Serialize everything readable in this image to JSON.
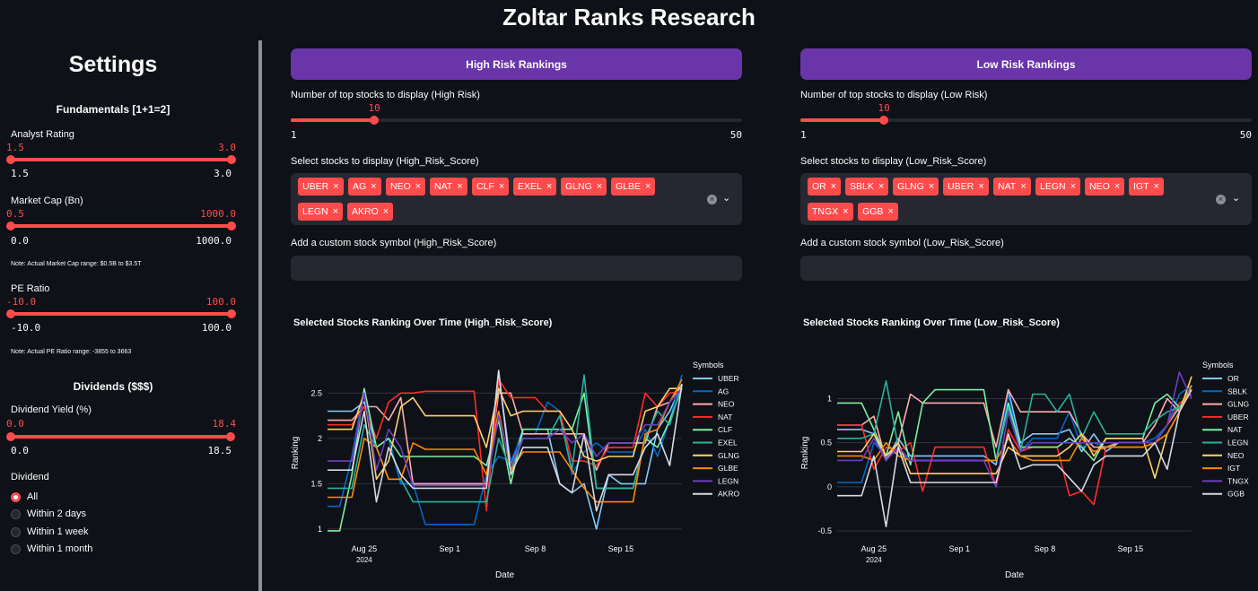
{
  "app": {
    "title": "Zoltar Ranks Research"
  },
  "sidebar": {
    "title": "Settings",
    "fundamentals_header": "Fundamentals [1+1=2]",
    "analyst_rating": {
      "label": "Analyst Rating",
      "low": "1.5",
      "high": "3.0",
      "min": "1.5",
      "max": "3.0",
      "low_frac": 0,
      "high_frac": 1
    },
    "market_cap": {
      "label": "Market Cap (Bn)",
      "low": "0.5",
      "high": "1000.0",
      "min": "0.0",
      "max": "1000.0",
      "note": "Note: Actual Market Cap range: $0.5B to $3.5T",
      "low_frac": 0,
      "high_frac": 1
    },
    "pe_ratio": {
      "label": "PE Ratio",
      "low": "-10.0",
      "high": "100.0",
      "min": "-10.0",
      "max": "100.0",
      "note": "Note: Actual PE Ratio range: -3855 to 3663",
      "low_frac": 0,
      "high_frac": 1
    },
    "dividends_header": "Dividends ($$$)",
    "dividend_yield": {
      "label": "Dividend Yield (%)",
      "low": "0.0",
      "high": "18.4",
      "min": "0.0",
      "max": "18.5",
      "low_frac": 0,
      "high_frac": 0.995
    },
    "dividend": {
      "label": "Dividend",
      "options": [
        "All",
        "Within 2 days",
        "Within 1 week",
        "Within 1 month"
      ],
      "selected": "All"
    }
  },
  "high": {
    "button": "High Risk Rankings",
    "slider_label": "Number of top stocks to display (High Risk)",
    "slider_value": "10",
    "slider_min": "1",
    "slider_max": "50",
    "slider_frac": 0.184,
    "select_label": "Select stocks to display (High_Risk_Score)",
    "chips": [
      "UBER",
      "AG",
      "NEO",
      "NAT",
      "CLF",
      "EXEL",
      "GLNG",
      "GLBE",
      "LEGN",
      "AKRO"
    ],
    "custom_label": "Add a custom stock symbol (High_Risk_Score)",
    "custom_value": ""
  },
  "low": {
    "button": "Low Risk Rankings",
    "slider_label": "Number of top stocks to display (Low Risk)",
    "slider_value": "10",
    "slider_min": "1",
    "slider_max": "50",
    "slider_frac": 0.184,
    "select_label": "Select stocks to display (Low_Risk_Score)",
    "chips": [
      "OR",
      "SBLK",
      "GLNG",
      "UBER",
      "NAT",
      "LEGN",
      "NEO",
      "IGT",
      "TNGX",
      "GGB"
    ],
    "custom_label": "Add a custom stock symbol (Low_Risk_Score)",
    "custom_value": ""
  },
  "chart_data": [
    {
      "type": "line",
      "title": "Selected Stocks Ranking Over Time (High_Risk_Score)",
      "xlabel": "Date",
      "ylabel": "Ranking",
      "legend_title": "Symbols",
      "x_ticks": [
        "Aug 25",
        "Sep 1",
        "Sep 8",
        "Sep 15"
      ],
      "x_tick_sub": "2024",
      "y_ticks": [
        1,
        1.5,
        2,
        2.5
      ],
      "ylim": [
        0.9,
        2.78
      ],
      "grid": true,
      "x": [
        "2024-08-22",
        "2024-08-23",
        "2024-08-24",
        "2024-08-25",
        "2024-08-26",
        "2024-08-27",
        "2024-08-28",
        "2024-08-29",
        "2024-08-30",
        "2024-08-31",
        "2024-09-01",
        "2024-09-02",
        "2024-09-03",
        "2024-09-04",
        "2024-09-05",
        "2024-09-06",
        "2024-09-07",
        "2024-09-08",
        "2024-09-09",
        "2024-09-10",
        "2024-09-11",
        "2024-09-12",
        "2024-09-13",
        "2024-09-14",
        "2024-09-15",
        "2024-09-16",
        "2024-09-17",
        "2024-09-18",
        "2024-09-19",
        "2024-09-20"
      ],
      "series": [
        {
          "name": "UBER",
          "color": "#83c9ff",
          "values": [
            2.3,
            2.3,
            2.3,
            2.4,
            1.9,
            2.0,
            1.5,
            1.5,
            1.5,
            1.5,
            1.5,
            1.5,
            1.5,
            1.5,
            2.7,
            1.7,
            2.1,
            2.1,
            2.1,
            1.5,
            1.4,
            1.5,
            1.0,
            1.6,
            1.5,
            1.5,
            1.5,
            2.1,
            2.3,
            2.6
          ]
        },
        {
          "name": "AG",
          "color": "#0068c9",
          "values": [
            1.25,
            1.25,
            1.8,
            2.55,
            1.9,
            2.0,
            1.5,
            1.5,
            1.05,
            1.05,
            1.05,
            1.05,
            1.05,
            1.6,
            1.8,
            1.75,
            2.05,
            2.05,
            2.4,
            2.3,
            1.6,
            1.85,
            1.95,
            1.85,
            1.85,
            1.85,
            2.1,
            1.8,
            2.2,
            2.7
          ]
        },
        {
          "name": "NEO",
          "color": "#ffabab",
          "values": [
            2.2,
            2.2,
            2.2,
            2.35,
            2.35,
            2.2,
            2.45,
            1.5,
            1.5,
            1.5,
            1.5,
            1.5,
            1.5,
            1.5,
            2.5,
            2.5,
            2.05,
            2.05,
            2.05,
            2.05,
            2.05,
            2.05,
            1.65,
            1.95,
            1.95,
            1.95,
            1.95,
            2.35,
            2.4,
            2.6
          ]
        },
        {
          "name": "NAT",
          "color": "#ff2b2b",
          "values": [
            2.15,
            2.15,
            2.15,
            2.35,
            2.0,
            2.4,
            2.5,
            2.5,
            2.52,
            2.52,
            2.52,
            2.52,
            2.52,
            1.2,
            2.65,
            2.45,
            2.45,
            2.45,
            2.3,
            2.3,
            1.75,
            1.75,
            1.7,
            1.9,
            1.9,
            1.9,
            2.5,
            2.35,
            2.5,
            2.52
          ]
        },
        {
          "name": "CLF",
          "color": "#7defa1",
          "values": [
            0.98,
            0.98,
            1.6,
            2.55,
            1.9,
            2.0,
            1.8,
            1.8,
            1.8,
            1.8,
            1.8,
            1.8,
            1.8,
            1.7,
            2.2,
            1.5,
            2.1,
            2.1,
            2.1,
            2.1,
            2.1,
            2.5,
            1.45,
            1.45,
            1.45,
            1.45,
            2.0,
            1.9,
            2.2,
            2.55
          ]
        },
        {
          "name": "EXEL",
          "color": "#29b09d",
          "values": [
            1.45,
            1.45,
            1.45,
            2.15,
            1.9,
            1.55,
            1.55,
            1.3,
            1.3,
            1.3,
            1.3,
            1.3,
            1.3,
            1.3,
            2.0,
            1.65,
            2.0,
            2.0,
            2.0,
            2.25,
            1.65,
            2.7,
            1.45,
            1.45,
            1.45,
            1.45,
            2.0,
            2.3,
            2.15,
            2.6
          ]
        },
        {
          "name": "GLNG",
          "color": "#ffd16a",
          "values": [
            2.1,
            2.1,
            2.1,
            2.5,
            1.55,
            1.75,
            2.35,
            2.45,
            2.25,
            2.25,
            2.25,
            2.25,
            2.25,
            1.9,
            2.55,
            2.25,
            2.3,
            2.3,
            2.3,
            2.3,
            2.1,
            1.8,
            1.75,
            1.8,
            1.8,
            1.8,
            2.3,
            2.35,
            2.55,
            2.55
          ]
        },
        {
          "name": "GLBE",
          "color": "#ff8700",
          "values": [
            1.35,
            1.35,
            1.35,
            2.0,
            1.9,
            1.55,
            1.55,
            1.95,
            1.88,
            1.88,
            1.88,
            1.88,
            1.88,
            1.6,
            2.3,
            1.65,
            1.85,
            1.85,
            1.85,
            1.85,
            1.65,
            1.45,
            1.3,
            1.3,
            1.3,
            1.3,
            2.05,
            2.1,
            2.4,
            2.65
          ]
        },
        {
          "name": "LEGN",
          "color": "#6d3fc0",
          "values": [
            1.75,
            1.75,
            1.75,
            2.5,
            1.65,
            2.1,
            1.9,
            1.48,
            1.48,
            1.48,
            1.48,
            1.48,
            1.48,
            1.48,
            2.25,
            1.7,
            2.0,
            2.0,
            2.0,
            2.1,
            1.95,
            2.05,
            1.8,
            1.95,
            1.95,
            1.95,
            2.15,
            2.15,
            2.4,
            2.55
          ]
        },
        {
          "name": "AKRO",
          "color": "#d5dae5",
          "values": [
            1.65,
            1.65,
            1.65,
            2.3,
            1.3,
            1.9,
            1.6,
            1.45,
            1.45,
            1.45,
            1.45,
            1.45,
            1.45,
            1.45,
            2.75,
            1.6,
            1.9,
            1.9,
            1.9,
            1.5,
            1.4,
            2.05,
            1.2,
            1.6,
            1.6,
            1.6,
            1.9,
            2.05,
            1.7,
            2.6
          ]
        }
      ]
    },
    {
      "type": "line",
      "title": "Selected Stocks Ranking Over Time (Low_Risk_Score)",
      "xlabel": "Date",
      "ylabel": "Ranking",
      "legend_title": "Symbols",
      "x_ticks": [
        "Aug 25",
        "Sep 1",
        "Sep 8",
        "Sep 15"
      ],
      "x_tick_sub": "2024",
      "y_ticks": [
        -0.5,
        0,
        0.5,
        1
      ],
      "ylim": [
        -0.58,
        1.35
      ],
      "grid": true,
      "x": [
        "2024-08-22",
        "2024-08-23",
        "2024-08-24",
        "2024-08-25",
        "2024-08-26",
        "2024-08-27",
        "2024-08-28",
        "2024-08-29",
        "2024-08-30",
        "2024-08-31",
        "2024-09-01",
        "2024-09-02",
        "2024-09-03",
        "2024-09-04",
        "2024-09-05",
        "2024-09-06",
        "2024-09-07",
        "2024-09-08",
        "2024-09-09",
        "2024-09-10",
        "2024-09-11",
        "2024-09-12",
        "2024-09-13",
        "2024-09-14",
        "2024-09-15",
        "2024-09-16",
        "2024-09-17",
        "2024-09-18",
        "2024-09-19",
        "2024-09-20"
      ],
      "series": [
        {
          "name": "OR",
          "color": "#83c9ff",
          "values": [
            0.65,
            0.65,
            0.65,
            0.6,
            0.3,
            0.55,
            0.35,
            0.35,
            0.35,
            0.35,
            0.35,
            0.35,
            0.35,
            0.25,
            1.1,
            0.5,
            0.6,
            0.6,
            0.6,
            0.65,
            0.4,
            0.6,
            0.4,
            0.5,
            0.5,
            0.5,
            0.5,
            0.7,
            0.9,
            1.1
          ]
        },
        {
          "name": "SBLK",
          "color": "#0068c9",
          "values": [
            0.05,
            0.05,
            0.05,
            0.5,
            0.35,
            0.4,
            0.3,
            0.3,
            0.3,
            0.3,
            0.3,
            0.3,
            0.3,
            0.3,
            1.05,
            0.4,
            0.55,
            0.55,
            0.55,
            0.85,
            0.45,
            0.5,
            0.45,
            0.5,
            0.5,
            0.5,
            0.55,
            0.7,
            1.05,
            1.15
          ]
        },
        {
          "name": "GLNG",
          "color": "#ffabab",
          "values": [
            0.7,
            0.7,
            0.7,
            0.8,
            0.3,
            0.5,
            1.05,
            0.95,
            0.95,
            0.95,
            0.95,
            0.95,
            0.95,
            0.45,
            1.1,
            0.85,
            0.85,
            0.85,
            0.85,
            0.85,
            0.6,
            0.45,
            0.45,
            0.5,
            0.5,
            0.5,
            0.7,
            1.0,
            0.85,
            1.15
          ]
        },
        {
          "name": "UBER",
          "color": "#ff2b2b",
          "values": [
            0.7,
            0.7,
            0.7,
            0.2,
            0.45,
            0.4,
            0.5,
            -0.05,
            0.45,
            0.45,
            0.45,
            0.45,
            0.45,
            0.0,
            0.65,
            0.4,
            0.45,
            0.45,
            0.45,
            -0.1,
            -0.05,
            -0.2,
            0.45,
            0.45,
            0.45,
            0.45,
            0.5,
            0.7,
            0.95,
            1.05
          ]
        },
        {
          "name": "NAT",
          "color": "#7defa1",
          "values": [
            0.95,
            0.95,
            0.95,
            0.65,
            0.35,
            0.85,
            0.25,
            0.95,
            1.1,
            1.1,
            1.1,
            1.1,
            1.1,
            0.3,
            0.95,
            0.45,
            0.45,
            0.45,
            0.45,
            0.55,
            0.45,
            0.3,
            0.55,
            0.55,
            0.55,
            0.55,
            0.95,
            1.05,
            0.9,
            1.1
          ]
        },
        {
          "name": "LEGN",
          "color": "#29b09d",
          "values": [
            0.55,
            0.55,
            0.55,
            0.6,
            1.2,
            0.45,
            0.3,
            0.3,
            0.3,
            0.3,
            0.3,
            0.3,
            0.3,
            0.3,
            0.9,
            0.4,
            1.05,
            1.05,
            0.85,
            1.05,
            0.55,
            0.85,
            0.6,
            0.6,
            0.6,
            0.6,
            0.75,
            0.85,
            0.9,
            1.15
          ]
        },
        {
          "name": "NEO",
          "color": "#ffd16a",
          "values": [
            0.4,
            0.4,
            0.4,
            0.6,
            0.35,
            0.5,
            0.15,
            0.15,
            0.15,
            0.15,
            0.15,
            0.15,
            0.15,
            0.15,
            0.45,
            0.35,
            0.35,
            0.35,
            0.35,
            0.45,
            0.6,
            0.35,
            0.55,
            0.55,
            0.55,
            0.55,
            0.1,
            0.6,
            0.85,
            1.25
          ]
        },
        {
          "name": "IGT",
          "color": "#ff8700",
          "values": [
            0.35,
            0.35,
            0.35,
            0.3,
            0.5,
            0.35,
            0.3,
            0.3,
            0.3,
            0.3,
            0.3,
            0.3,
            0.3,
            0.3,
            0.55,
            0.35,
            0.3,
            0.3,
            0.3,
            0.3,
            0.55,
            0.4,
            0.45,
            0.45,
            0.45,
            0.45,
            0.5,
            0.6,
            0.85,
            1.15
          ]
        },
        {
          "name": "TNGX",
          "color": "#6d3fc0",
          "values": [
            0.3,
            0.3,
            0.3,
            0.55,
            0.3,
            0.45,
            0.3,
            0.3,
            0.3,
            0.3,
            0.3,
            0.3,
            0.3,
            0.0,
            0.85,
            0.4,
            0.5,
            0.5,
            0.5,
            0.5,
            0.5,
            0.5,
            0.5,
            0.5,
            0.5,
            0.5,
            0.5,
            0.7,
            1.3,
            1.0
          ]
        },
        {
          "name": "GGB",
          "color": "#d5dae5",
          "values": [
            -0.1,
            -0.1,
            -0.1,
            0.35,
            -0.45,
            0.45,
            0.05,
            0.05,
            0.05,
            0.05,
            0.05,
            0.05,
            0.05,
            0.05,
            0.6,
            0.2,
            0.25,
            0.25,
            0.25,
            0.1,
            -0.05,
            0.25,
            0.35,
            0.35,
            0.35,
            0.35,
            0.5,
            0.2,
            0.85,
            1.1
          ]
        }
      ]
    }
  ]
}
